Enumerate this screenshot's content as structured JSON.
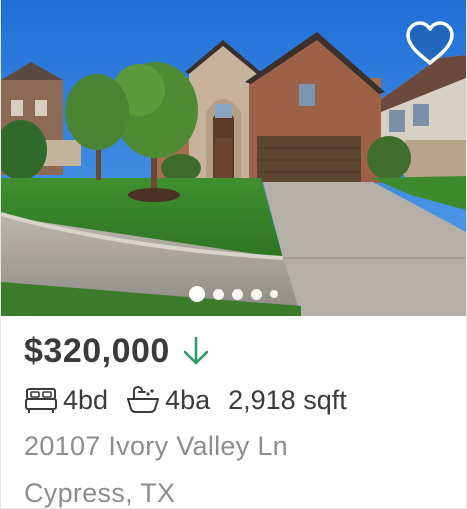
{
  "listing": {
    "price": "$320,000",
    "price_trend_icon": "arrow-down-icon",
    "beds": "4bd",
    "baths": "4ba",
    "sqft": "2,918 sqft",
    "address_line": "20107 Ivory Valley Ln",
    "city_state": "Cypress, TX"
  },
  "photo": {
    "favorite_icon": "heart-outline-icon",
    "carousel_dots": 5,
    "active_dot": 1
  },
  "colors": {
    "price_trend": "#2d9a6a",
    "text_primary": "#3b3b3b",
    "text_secondary": "#8d8d8d",
    "sky": "#2f7fd8"
  }
}
